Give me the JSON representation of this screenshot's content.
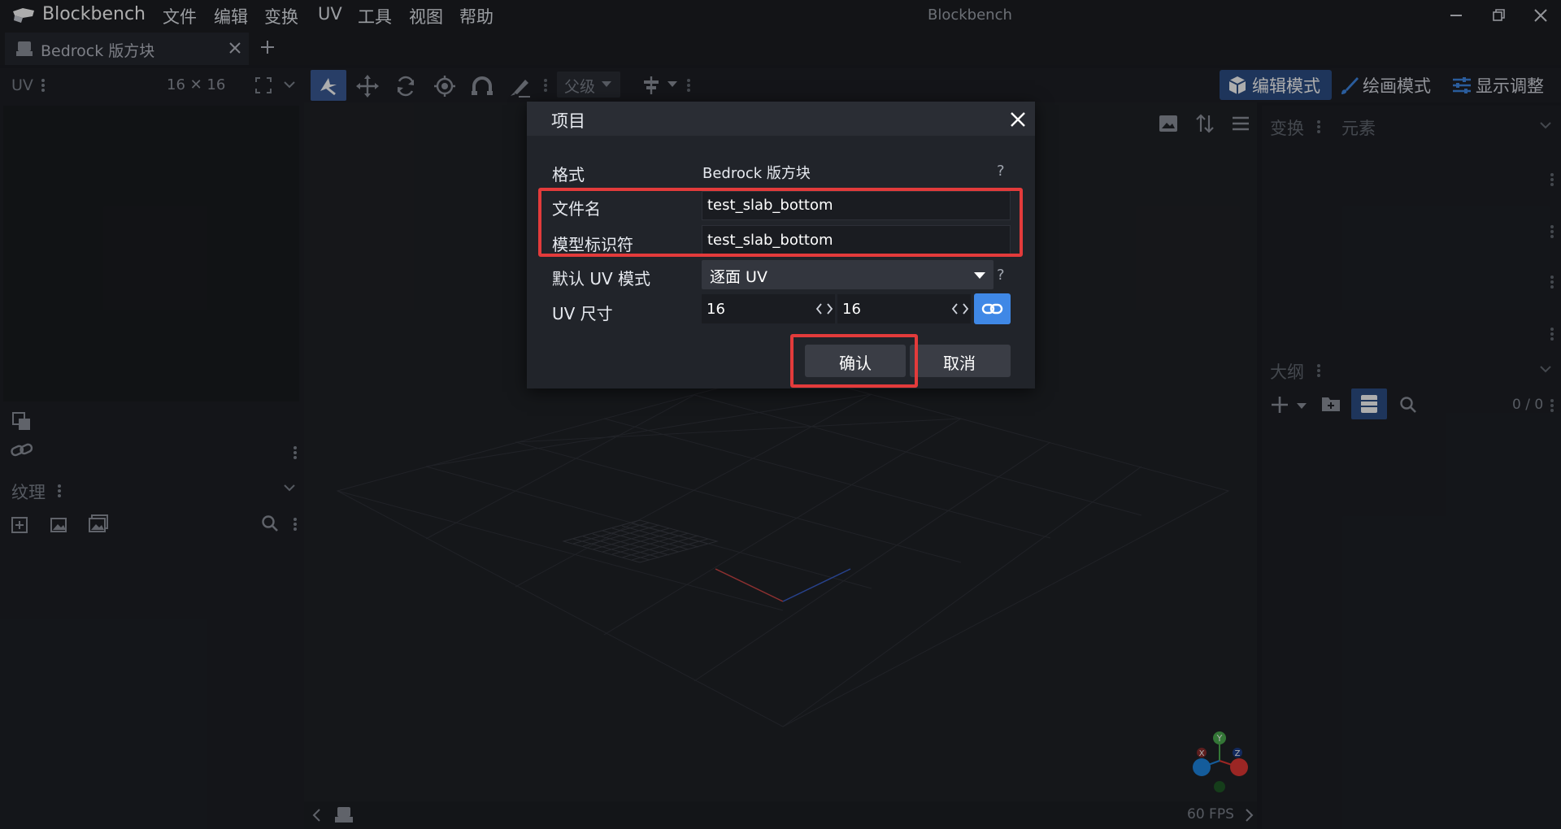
{
  "app": {
    "name": "Blockbench",
    "window_title": "Blockbench",
    "menu": [
      "文件",
      "编辑",
      "变换",
      "UV",
      "工具",
      "视图",
      "帮助"
    ]
  },
  "tabs": [
    {
      "label": "Bedrock 版方块",
      "active": true
    }
  ],
  "left_panel": {
    "uv_label": "UV",
    "uv_size": "16 ✕ 16",
    "texture_label": "纹理"
  },
  "toolbar": {
    "parent_label": "父级",
    "modes": {
      "edit": "编辑模式",
      "paint": "绘画模式",
      "display": "显示调整"
    }
  },
  "right_panel": {
    "transform_label": "变换",
    "element_label": "元素",
    "outline_label": "大纲",
    "outline_count": "0 / 0"
  },
  "viewport": {
    "fps": "60 FPS",
    "axis_x": "X",
    "axis_y": "Y",
    "axis_z": "Z"
  },
  "dialog": {
    "title": "项目",
    "fields": {
      "format": {
        "label": "格式",
        "value": "Bedrock 版方块"
      },
      "filename": {
        "label": "文件名",
        "value": "test_slab_bottom"
      },
      "identifier": {
        "label": "模型标识符",
        "value": "test_slab_bottom"
      },
      "uv_mode": {
        "label": "默认 UV 模式",
        "value": "逐面 UV"
      },
      "uv_size": {
        "label": "UV 尺寸",
        "width": "16",
        "height": "16"
      }
    },
    "help_mark": "?",
    "confirm": "确认",
    "cancel": "取消"
  },
  "colors": {
    "accent": "#3f88e6",
    "mode_active": "#2d4f86",
    "highlight": "#e33b3b"
  }
}
